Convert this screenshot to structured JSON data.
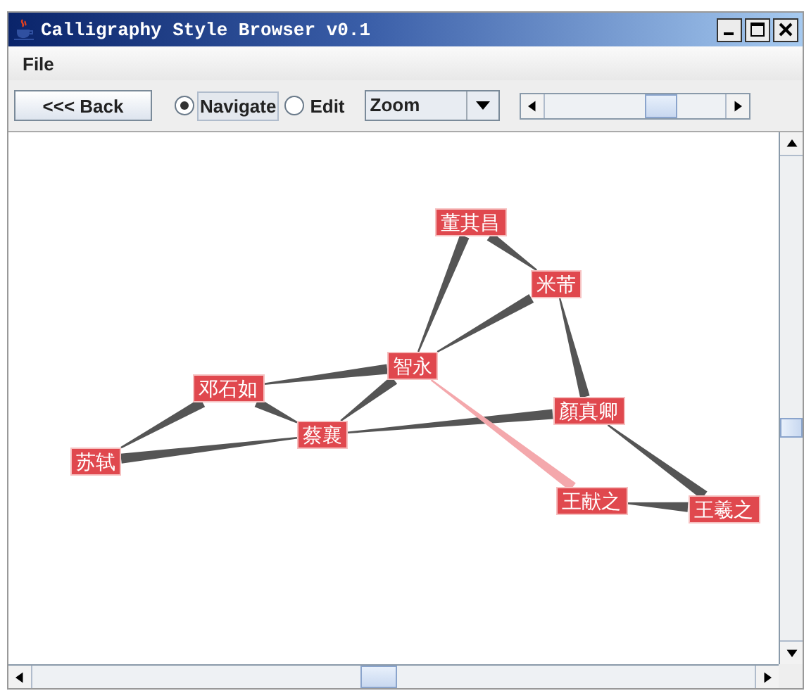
{
  "window": {
    "title": "Calligraphy Style Browser v0.1"
  },
  "menu": [
    "File"
  ],
  "toolbar": {
    "back_button": "<<< Back",
    "modes": [
      {
        "label": "Navigate",
        "selected": true
      },
      {
        "label": "Edit",
        "selected": false
      }
    ],
    "zoom": {
      "value": "Zoom"
    }
  },
  "graph": {
    "nodes": [
      {
        "name": "董其昌"
      },
      {
        "name": "米芾"
      },
      {
        "name": "智永"
      },
      {
        "name": "邓石如"
      },
      {
        "name": "顏真卿"
      },
      {
        "name": "蔡襄"
      },
      {
        "name": "苏轼"
      },
      {
        "name": "王献之"
      },
      {
        "name": "王羲之"
      }
    ],
    "edges": [
      {
        "highlighted": false
      },
      {
        "highlighted": false
      },
      {
        "highlighted": false
      },
      {
        "highlighted": false
      },
      {
        "highlighted": false
      },
      {
        "highlighted": false
      },
      {
        "highlighted": false
      },
      {
        "highlighted": false
      },
      {
        "highlighted": false
      },
      {
        "highlighted": false
      },
      {
        "highlighted": true
      },
      {
        "highlighted": false
      },
      {
        "highlighted": false
      }
    ]
  }
}
